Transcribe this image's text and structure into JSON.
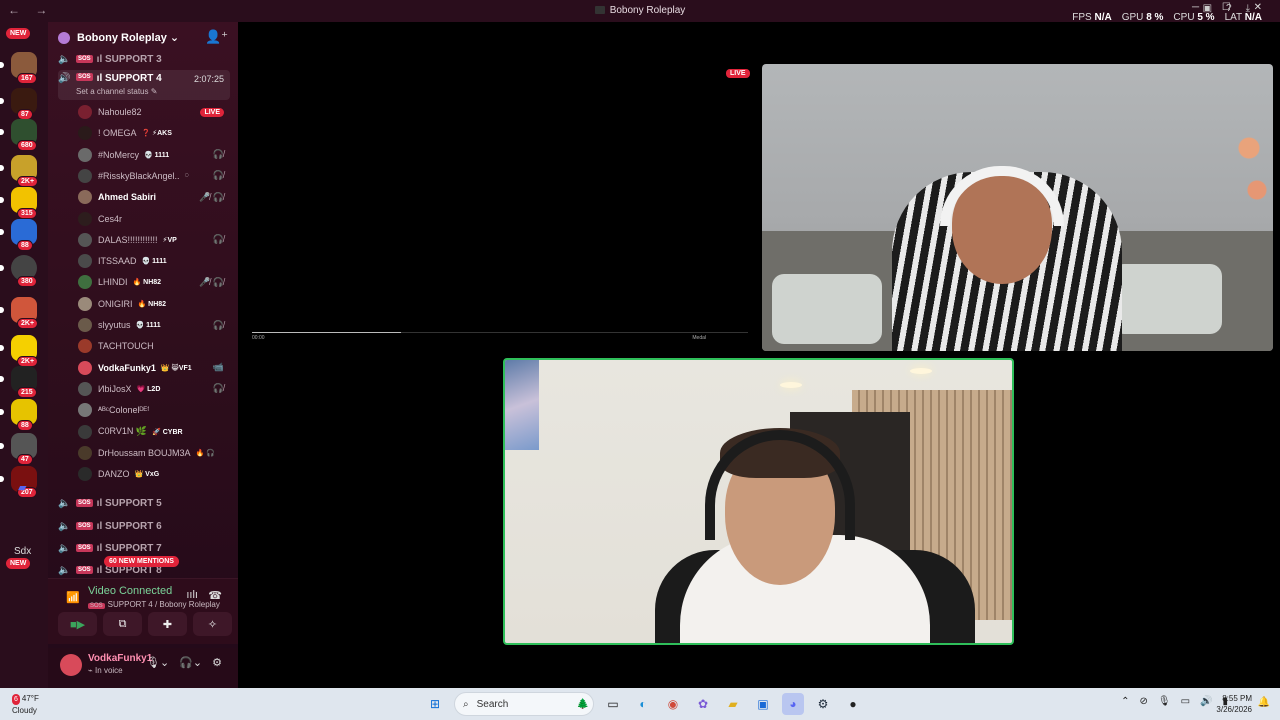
{
  "window": {
    "title": "Bobony Roleplay",
    "nav": "← →",
    "controls": "─ ☐ ✕"
  },
  "overlay": {
    "fps_label": "FPS",
    "fps_value": "N/A",
    "gpu_label": "GPU",
    "gpu_value": "8 %",
    "cpu_label": "CPU",
    "cpu_value": "5 %",
    "lat_label": "LAT",
    "lat_value": "N/A"
  },
  "guilds": {
    "new_top": "NEW",
    "new_bottom": "NEW",
    "sdx_label": "Sdx",
    "badges": [
      "167",
      "87",
      "680",
      "2K+",
      "315",
      "88",
      "380",
      "2K+",
      "2K+",
      "215",
      "88",
      "47",
      "207"
    ],
    "colors": [
      "#8b5a3c",
      "#3a1a10",
      "#2f4f2f",
      "#c8a12a",
      "#f2c200",
      "#2a6bd6",
      "#444",
      "#d0563b",
      "#f5d000",
      "#222",
      "#e6c300",
      "#555",
      "#7a1010"
    ]
  },
  "server": {
    "name": "Bobony Roleplay",
    "invite_icon": "add-member-icon"
  },
  "channels": {
    "support3": "SUPPORT 3",
    "support4": "SUPPORT 4",
    "support4_time": "2:07:25",
    "support4_status": "Set a channel status",
    "support5": "SUPPORT 5",
    "support6": "SUPPORT 6",
    "support7": "SUPPORT 7",
    "support8": "SUPPORT 8",
    "tag": "SOS",
    "prefix": "ıl"
  },
  "members": [
    {
      "name": "Nahoule82",
      "tag": "",
      "right": "",
      "live": "LIVE",
      "color": "#7a2030",
      "bold": false
    },
    {
      "name": "! OMEGA",
      "tag": "❓ ⚡AKS",
      "right": "",
      "live": "",
      "color": "#2a1a1a",
      "bold": false
    },
    {
      "name": "#NoMercy",
      "tag": "💀 1111",
      "right": "🎧̸",
      "live": "",
      "color": "#6a6a6a",
      "bold": false
    },
    {
      "name": "#RisskyBlackAngel..",
      "tag": "◌",
      "right": "🎧̸",
      "live": "",
      "color": "#444",
      "bold": false
    },
    {
      "name": "Ahmed Sabiri",
      "tag": "",
      "right": "🎤̸ 🎧̸",
      "live": "",
      "color": "#8a6a5a",
      "bold": true
    },
    {
      "name": "Ces4r",
      "tag": "",
      "right": "",
      "live": "",
      "color": "#2d1d1d",
      "bold": false
    },
    {
      "name": "DALAS!!!!!!!!!!!!",
      "tag": "⚡VP",
      "right": "🎧̸",
      "live": "",
      "color": "#555",
      "bold": false
    },
    {
      "name": "ITSSAAD",
      "tag": "💀 1111",
      "right": "",
      "live": "",
      "color": "#4a4a4a",
      "bold": false
    },
    {
      "name": "LHINDI",
      "tag": "🔥 NH82",
      "right": "🎤̸ 🎧̸",
      "live": "",
      "color": "#3f6f3f",
      "bold": false
    },
    {
      "name": "ONIGIRI",
      "tag": "🔥 NH82",
      "right": "",
      "live": "",
      "color": "#9a8a7a",
      "bold": false
    },
    {
      "name": "slyyutus",
      "tag": "💀 1111",
      "right": "🎧̸",
      "live": "",
      "color": "#6a5a4a",
      "bold": false
    },
    {
      "name": "TACHTOUCH",
      "tag": "",
      "right": "",
      "live": "",
      "color": "#9a3a2a",
      "bold": false
    },
    {
      "name": "VodkaFunky1",
      "tag": "👑 😸VF1",
      "right": "📹",
      "live": "",
      "color": "#d84a5a",
      "bold": true
    },
    {
      "name": "ИbiJosX",
      "tag": "💗 L2D",
      "right": "🎧̸",
      "live": "",
      "color": "#555",
      "bold": false
    },
    {
      "name": "ᴬᴮᶜColonelᴰᴱᶠ",
      "tag": "",
      "right": "",
      "live": "",
      "color": "#777",
      "bold": false
    },
    {
      "name": "C0RV1N 🌿",
      "tag": "🚀 CYBR",
      "right": "",
      "live": "",
      "color": "#3a3a3a",
      "bold": false
    },
    {
      "name": "DrHoussam BOUJM3A",
      "tag": "🔥 🎧",
      "right": "",
      "live": "",
      "color": "#4a3a2a",
      "bold": false
    },
    {
      "name": "DANZO",
      "tag": "👑 VxG",
      "right": "",
      "live": "",
      "color": "#2a2a2a",
      "bold": false
    }
  ],
  "mentions": "60 NEW MENTIONS",
  "voice": {
    "connected": "Video Connected",
    "location": "SUPPORT 4 / Bobony Roleplay"
  },
  "user": {
    "name": "VodkaFunky1",
    "status": "In voice"
  },
  "stream": {
    "live": "LIVE",
    "time": "00:00",
    "quality": "Medal"
  },
  "taskbar": {
    "weather_temp": "47°F",
    "weather_desc": "Cloudy",
    "weather_badge": "6",
    "search_placeholder": "Search",
    "time": "8:55 PM",
    "date": "3/26/2026"
  }
}
